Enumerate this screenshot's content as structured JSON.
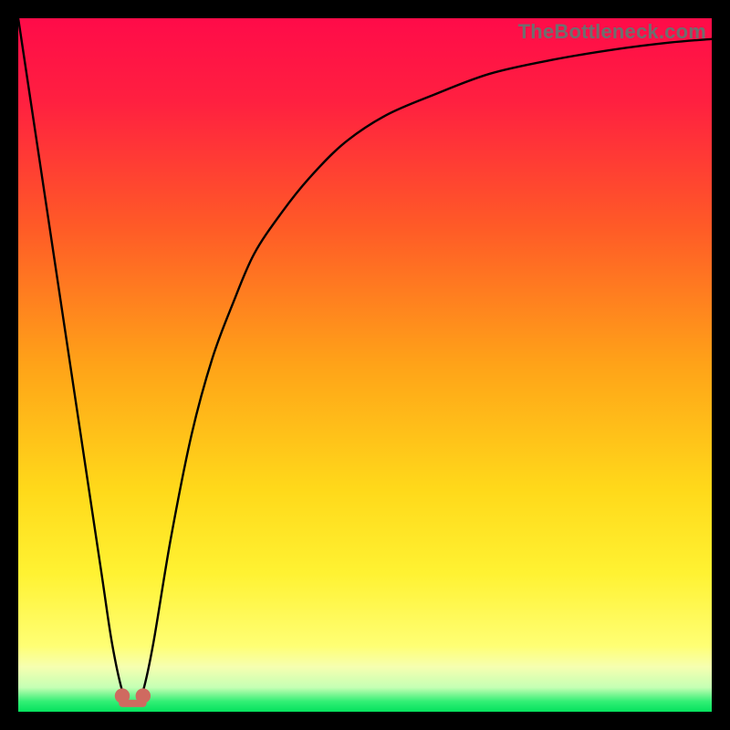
{
  "watermark": "TheBottleneck.com",
  "colors": {
    "background": "#000000",
    "watermark": "#6e6e6e",
    "curve": "#000000",
    "marker": "#cf6a60",
    "gradient_stops": [
      {
        "y": 0.0,
        "color": "#ff0b49"
      },
      {
        "y": 0.12,
        "color": "#ff2040"
      },
      {
        "y": 0.3,
        "color": "#ff5a27"
      },
      {
        "y": 0.5,
        "color": "#ffa318"
      },
      {
        "y": 0.68,
        "color": "#ffd91a"
      },
      {
        "y": 0.8,
        "color": "#fff232"
      },
      {
        "y": 0.905,
        "color": "#ffff74"
      },
      {
        "y": 0.935,
        "color": "#f6ffb0"
      },
      {
        "y": 0.965,
        "color": "#c5ffb4"
      },
      {
        "y": 0.985,
        "color": "#33ef75"
      },
      {
        "y": 1.0,
        "color": "#05e25e"
      }
    ]
  },
  "chart_data": {
    "type": "line",
    "title": "",
    "xlabel": "",
    "ylabel": "",
    "xlim": [
      0,
      100
    ],
    "ylim": [
      0,
      100
    ],
    "grid": false,
    "legend": false,
    "annotations": [
      "TheBottleneck.com"
    ],
    "series": [
      {
        "name": "bottleneck-curve",
        "x": [
          0,
          3,
          6,
          9,
          12,
          13.5,
          15,
          16,
          17,
          18,
          19.5,
          22,
          25,
          28,
          31,
          34,
          38,
          42,
          47,
          53,
          60,
          68,
          77,
          86,
          94,
          100
        ],
        "y": [
          100,
          80,
          60,
          40,
          20,
          10,
          3,
          1.3,
          1.3,
          3,
          10,
          25,
          40,
          51,
          59,
          66,
          72,
          77,
          82,
          86,
          89,
          92,
          94,
          95.5,
          96.5,
          97
        ]
      }
    ],
    "markers": [
      {
        "name": "base-marker-left",
        "x": 15.0,
        "y": 1.5,
        "r": 1.2
      },
      {
        "name": "base-marker-right",
        "x": 18.0,
        "y": 1.5,
        "r": 1.2
      }
    ],
    "trough_band": {
      "x_start": 14.5,
      "x_end": 18.5,
      "y": 1.2
    }
  }
}
